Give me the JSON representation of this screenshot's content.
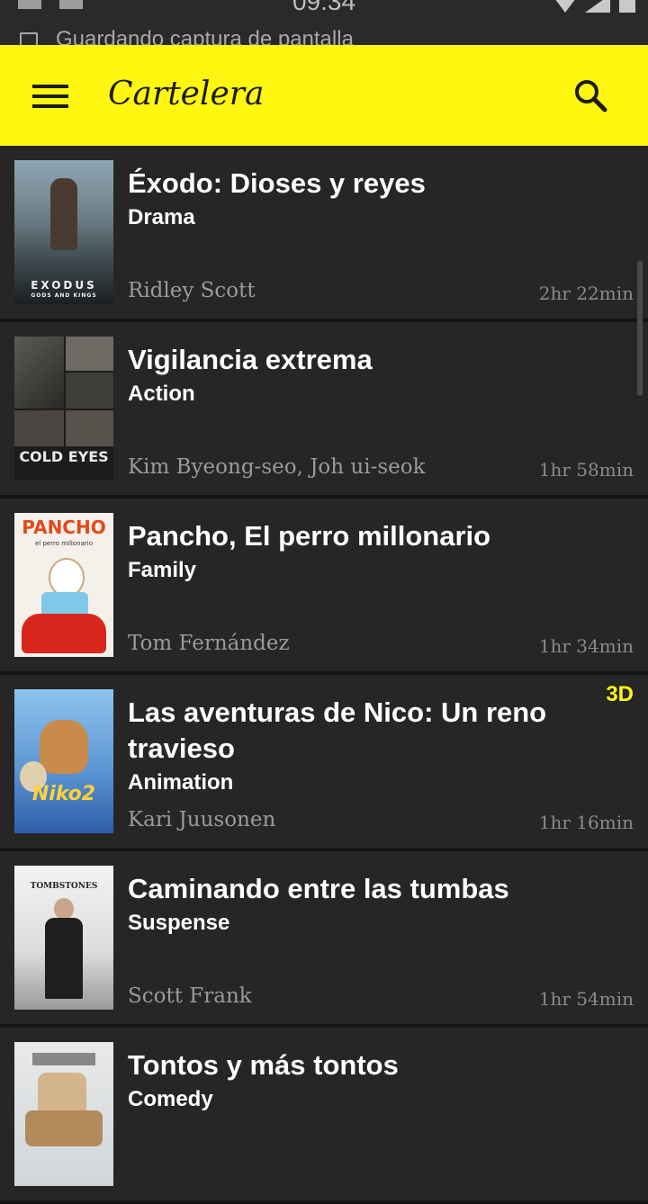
{
  "status_bar": {
    "time": "09:34",
    "notification": "Guardando captura de pantalla"
  },
  "toolbar": {
    "title": "Cartelera",
    "background": "#fff710"
  },
  "movies": [
    {
      "title": "Éxodo: Dioses y reyes",
      "genre": "Drama",
      "director": "Ridley Scott",
      "duration": "2hr 22min",
      "badge": "",
      "poster_text": "EXODUS",
      "poster_subtext": "GODS AND KINGS"
    },
    {
      "title": "Vigilancia extrema",
      "genre": "Action",
      "director": "Kim Byeong-seo, Joh ui-seok",
      "duration": "1hr 58min",
      "badge": "",
      "poster_text": "COLD EYES",
      "poster_subtext": ""
    },
    {
      "title": "Pancho, El perro millonario",
      "genre": "Family",
      "director": "Tom Fernández",
      "duration": "1hr 34min",
      "badge": "",
      "poster_text": "PANCHO",
      "poster_subtext": "el perro millonario"
    },
    {
      "title": "Las aventuras de Nico: Un reno travieso",
      "genre": "Animation",
      "director": "Kari Juusonen",
      "duration": "1hr 16min",
      "badge": "3D",
      "poster_text": "Niko2",
      "poster_subtext": ""
    },
    {
      "title": "Caminando entre las tumbas",
      "genre": "Suspense",
      "director": "Scott Frank",
      "duration": "1hr 54min",
      "badge": "",
      "poster_text": "TOMBSTONES",
      "poster_subtext": ""
    },
    {
      "title": "Tontos y más tontos",
      "genre": "Comedy",
      "director": "",
      "duration": "",
      "badge": "",
      "poster_text": "",
      "poster_subtext": ""
    }
  ],
  "colors": {
    "accent": "#fff710",
    "badge": "#fff710",
    "background": "#262626"
  },
  "icons": {
    "menu": "menu-icon",
    "search": "search-icon"
  }
}
